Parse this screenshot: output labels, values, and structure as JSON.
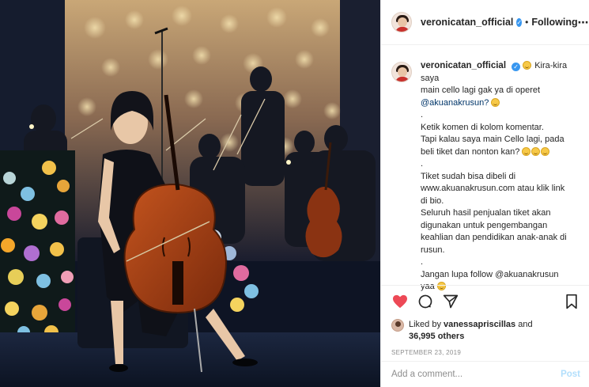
{
  "post": {
    "username": "veronicatan_official",
    "verified_badge": "✓",
    "separator": "•",
    "follow_state": "Following",
    "more_icon": "⋯"
  },
  "caption": {
    "username": "veronicatan_official",
    "lines": [
      "Kira-kira saya",
      "main cello lagi gak ya di operet",
      "@akuanakrusun?",
      ".",
      "Ketik komen di kolom komentar.",
      "Tapi kalau saya main Cello lagi, pada",
      "beli tiket dan nonton kan?",
      ".",
      "Tiket sudah bisa dibeli di",
      "www.akuanakrusun.com atau klik link",
      "di bio.",
      "Seluruh hasil penjualan tiket akan",
      "digunakan untuk pengembangan",
      "keahlian dan pendidikan anak-anak di",
      "rusun.",
      ".",
      "Jangan lupa follow @akuanakrusun",
      "yaa"
    ]
  },
  "likes": {
    "prefix": "Liked by",
    "user": "vanessapriscillas",
    "joiner": "and",
    "count": "36,995 others"
  },
  "date": "SEPTEMBER 23, 2019",
  "comment": {
    "placeholder": "Add a comment...",
    "post_label": "Post"
  },
  "colors": {
    "heart": "#ed4956",
    "link": "#003569",
    "post_disabled": "#b2dffc"
  },
  "icons": [
    "heart-icon",
    "comment-icon",
    "share-icon",
    "bookmark-icon",
    "more-icon"
  ]
}
